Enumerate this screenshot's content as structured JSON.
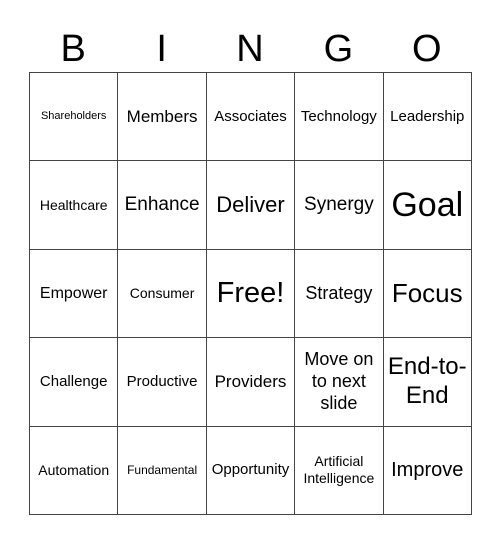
{
  "header": {
    "letters": [
      "B",
      "I",
      "N",
      "G",
      "O"
    ]
  },
  "grid": {
    "rows": [
      [
        "Shareholders",
        "Members",
        "Associates",
        "Technology",
        "Leadership"
      ],
      [
        "Healthcare",
        "Enhance",
        "Deliver",
        "Synergy",
        "Goal"
      ],
      [
        "Empower",
        "Consumer",
        "Free!",
        "Strategy",
        "Focus"
      ],
      [
        "Challenge",
        "Productive",
        "Providers",
        "Move on to next slide",
        "End-to-End"
      ],
      [
        "Automation",
        "Fundamental",
        "Opportunity",
        "Artificial Intelligence",
        "Improve"
      ]
    ]
  }
}
